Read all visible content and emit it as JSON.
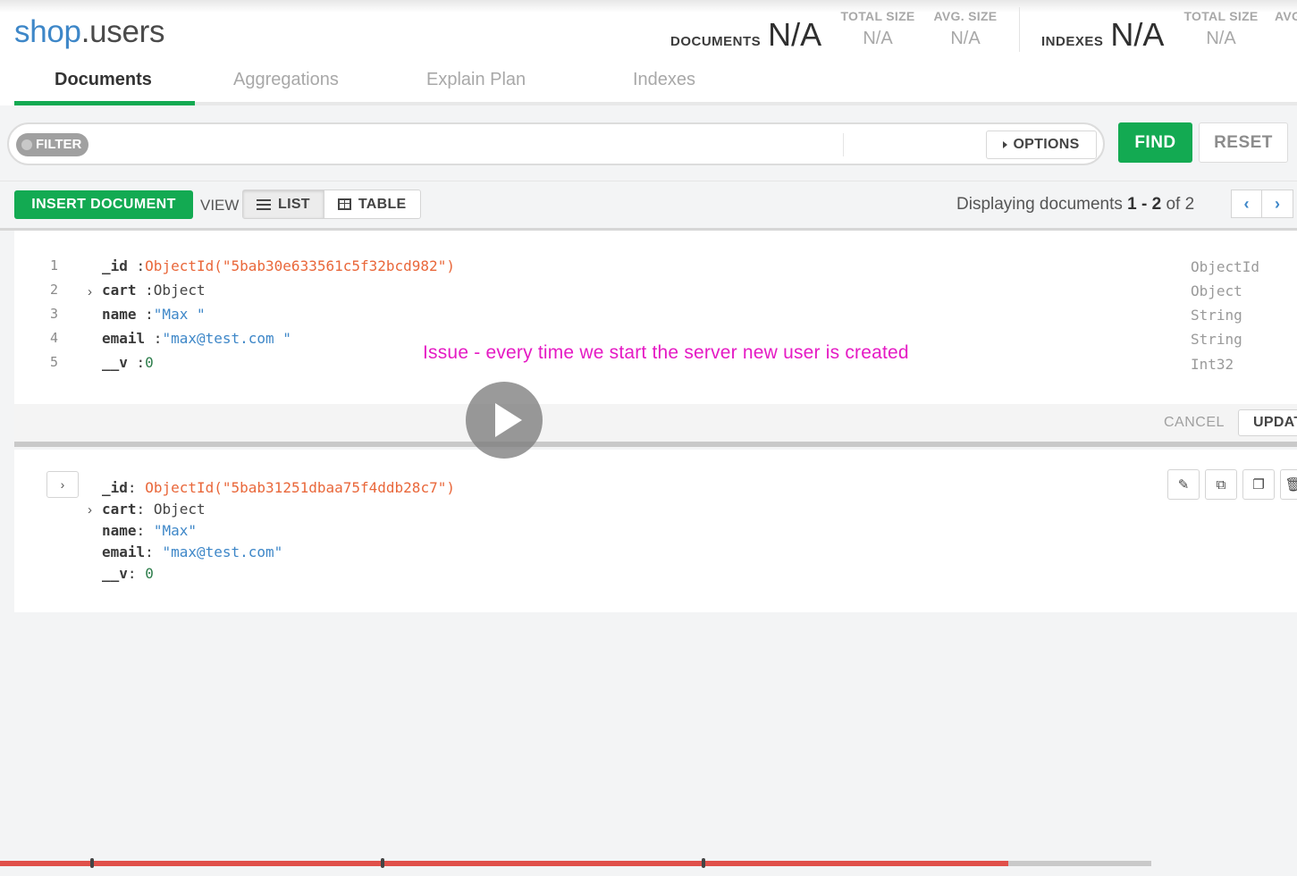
{
  "namespace": {
    "db": "shop",
    "collection": ".users"
  },
  "stats": {
    "documents": {
      "label": "DOCUMENTS",
      "value": "N/A"
    },
    "doc_total_size": {
      "label": "TOTAL SIZE",
      "value": "N/A"
    },
    "doc_avg_size": {
      "label": "AVG. SIZE",
      "value": "N/A"
    },
    "indexes": {
      "label": "INDEXES",
      "value": "N/A"
    },
    "idx_total_size": {
      "label": "TOTAL SIZE",
      "value": "N/A"
    },
    "idx_avg_size": {
      "label": "AVG",
      "value": ""
    }
  },
  "tabs": [
    {
      "label": "Documents",
      "active": true
    },
    {
      "label": "Aggregations"
    },
    {
      "label": "Explain Plan"
    },
    {
      "label": "Indexes"
    }
  ],
  "query": {
    "filter_label": "FILTER",
    "options_label": "OPTIONS",
    "find_label": "FIND",
    "reset_label": "RESET"
  },
  "toolbar": {
    "insert_label": "INSERT DOCUMENT",
    "view_label": "VIEW",
    "list_label": "LIST",
    "table_label": "TABLE",
    "display_prefix": "Displaying documents",
    "display_start": "1",
    "display_dash": "-",
    "display_end": "2",
    "display_of": "of 2"
  },
  "doc1": {
    "line_numbers": [
      "1",
      "2",
      "3",
      "4",
      "5"
    ],
    "fields": [
      {
        "key": "_id",
        "sep": " :",
        "value": "ObjectId(\"5bab30e633561c5f32bcd982\")",
        "type": "ObjectId"
      },
      {
        "key": "cart",
        "sep": " :",
        "value": "Object",
        "type": "Object"
      },
      {
        "key": "name",
        "sep": " :",
        "value": "\"Max \"",
        "type": "String"
      },
      {
        "key": "email",
        "sep": " :",
        "value": "\"max@test.com \"",
        "type": "String"
      },
      {
        "key": "__v",
        "sep": " :",
        "value": "0",
        "type": "Int32"
      }
    ],
    "cancel_label": "CANCEL",
    "update_label": "UPDATE"
  },
  "doc2": {
    "fields": [
      {
        "key": "_id",
        "sep": ":",
        "value": "ObjectId(\"5bab31251dbaa75f4ddb28c7\")"
      },
      {
        "key": "cart",
        "sep": ":",
        "value": "Object"
      },
      {
        "key": "name",
        "sep": ":",
        "value": "\"Max\""
      },
      {
        "key": "email",
        "sep": ":",
        "value": "\"max@test.com\""
      },
      {
        "key": "__v",
        "sep": ":",
        "value": "0"
      }
    ]
  },
  "overlay": {
    "caption": "Issue - every time we start the server new user is created"
  },
  "video": {
    "progress_fraction": 0.876
  },
  "colors": {
    "accent_green": "#13aa52",
    "brand_blue": "#3e87c8",
    "caption_magenta": "#e51bc4",
    "progress_red": "#e0504a"
  }
}
